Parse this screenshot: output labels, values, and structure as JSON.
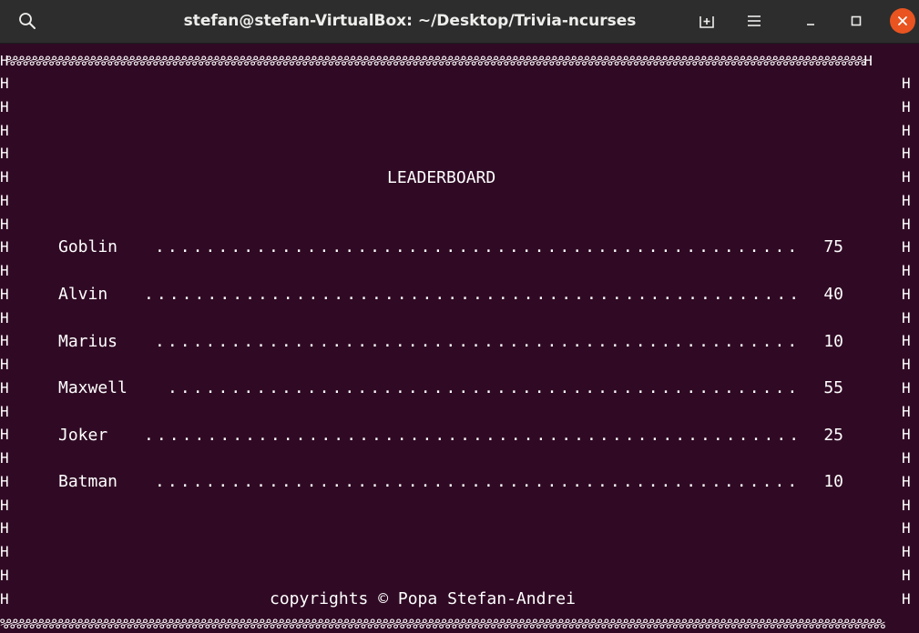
{
  "window": {
    "title": "stefan@stefan-VirtualBox: ~/Desktop/Trivia-ncurses"
  },
  "titlebar_icons": {
    "search": "search-icon",
    "new_tab": "new-tab-icon",
    "menu": "hamburger-menu-icon",
    "minimize": "minimize-icon",
    "maximize": "maximize-icon",
    "close": "close-icon"
  },
  "terminal": {
    "border_top": "H%%%%%%%%%%%%%%%%%%%%%%%%%%%%%%%%%%%%%%%%%%%%%%%%%%%%%%%%%%%%%%%%%%%%%%%%%%%%%%%%%%%%%%%%%%%%%%%%%%%%%%%%%%%%%%%%%%%%%%%%%%%%%%%%%%%%H",
    "border_bottom": "%%%%%%%%%%%%%%%%%%%%%%%%%%%%%%%%%%%%%%%%%%%%%%%%%%%%%%%%%%%%%%%%%%%%%%%%%%%%%%%%%%%%%%%%%%%%%%%%%%%%%%%%%%%%%%%%%%%%%%%%%%%%%%%%%%%%%%%%",
    "side_char": "H",
    "leaderboard_title": "LEADERBOARD",
    "entries": [
      {
        "name": "Goblin",
        "dots": "................................................................",
        "score": "75"
      },
      {
        "name": "Alvin",
        "dots": "................................................................",
        "score": "40"
      },
      {
        "name": "Marius",
        "dots": "................................................................",
        "score": "10"
      },
      {
        "name": "Maxwell",
        "dots": "................................................................",
        "score": "55"
      },
      {
        "name": "Joker",
        "dots": "................................................................",
        "score": "25"
      },
      {
        "name": "Batman",
        "dots": "................................................................",
        "score": "10"
      }
    ],
    "copyright": "copyrights © Popa Stefan-Andrei"
  },
  "colors": {
    "terminal_bg": "#300a24",
    "titlebar_bg": "#2d2d2d",
    "close_button": "#e95420",
    "text": "#ffffff"
  }
}
